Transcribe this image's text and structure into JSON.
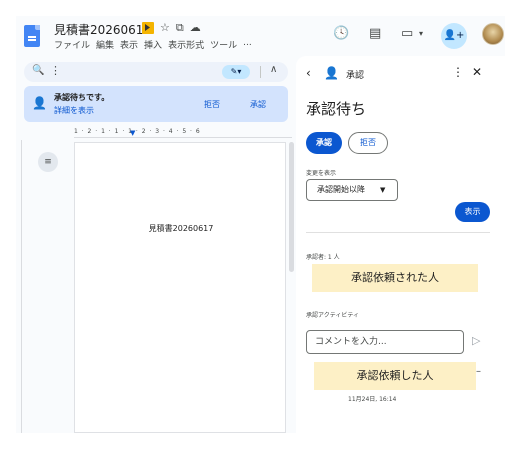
{
  "header": {
    "doc_title": "見積書20260617",
    "menus": [
      "ファイル",
      "編集",
      "表示",
      "挿入",
      "表示形式",
      "ツール",
      "..."
    ],
    "share_icon": "👤+"
  },
  "toolbar": {
    "search_icon": "🔍",
    "kebab_icon": "⋮",
    "edit_mode_icon": "✎▾",
    "collapse_icon": "∧"
  },
  "pending_bar": {
    "title": "承認待ちです。",
    "detail_link": "詳細を表示",
    "reject": "拒否",
    "approve": "承認"
  },
  "ruler": {
    "ticks": "1 · 2 · 1 · 1 · 1 · 2 · 3 · 4 · 5 · 6"
  },
  "document": {
    "body_text": "見積書20260617"
  },
  "panel": {
    "title": "承認",
    "heading": "承認待ち",
    "approve_button": "承認",
    "reject_button": "拒否",
    "changes_label": "変更を表示",
    "changes_select": "承認開始以降",
    "show_button": "表示",
    "approvers_label": "承認者: 1 人",
    "note_requested": "承認依頼された人",
    "activity_label": "承認アクティビティ",
    "comment_placeholder": "コメントを入力...",
    "note_requester": "承認依頼した人",
    "timestamp": "11月24日, 16:14"
  },
  "colors": {
    "accent": "#0b57d0",
    "pending_bg": "#d3e3fd",
    "note_bg": "#fdf0c6"
  }
}
